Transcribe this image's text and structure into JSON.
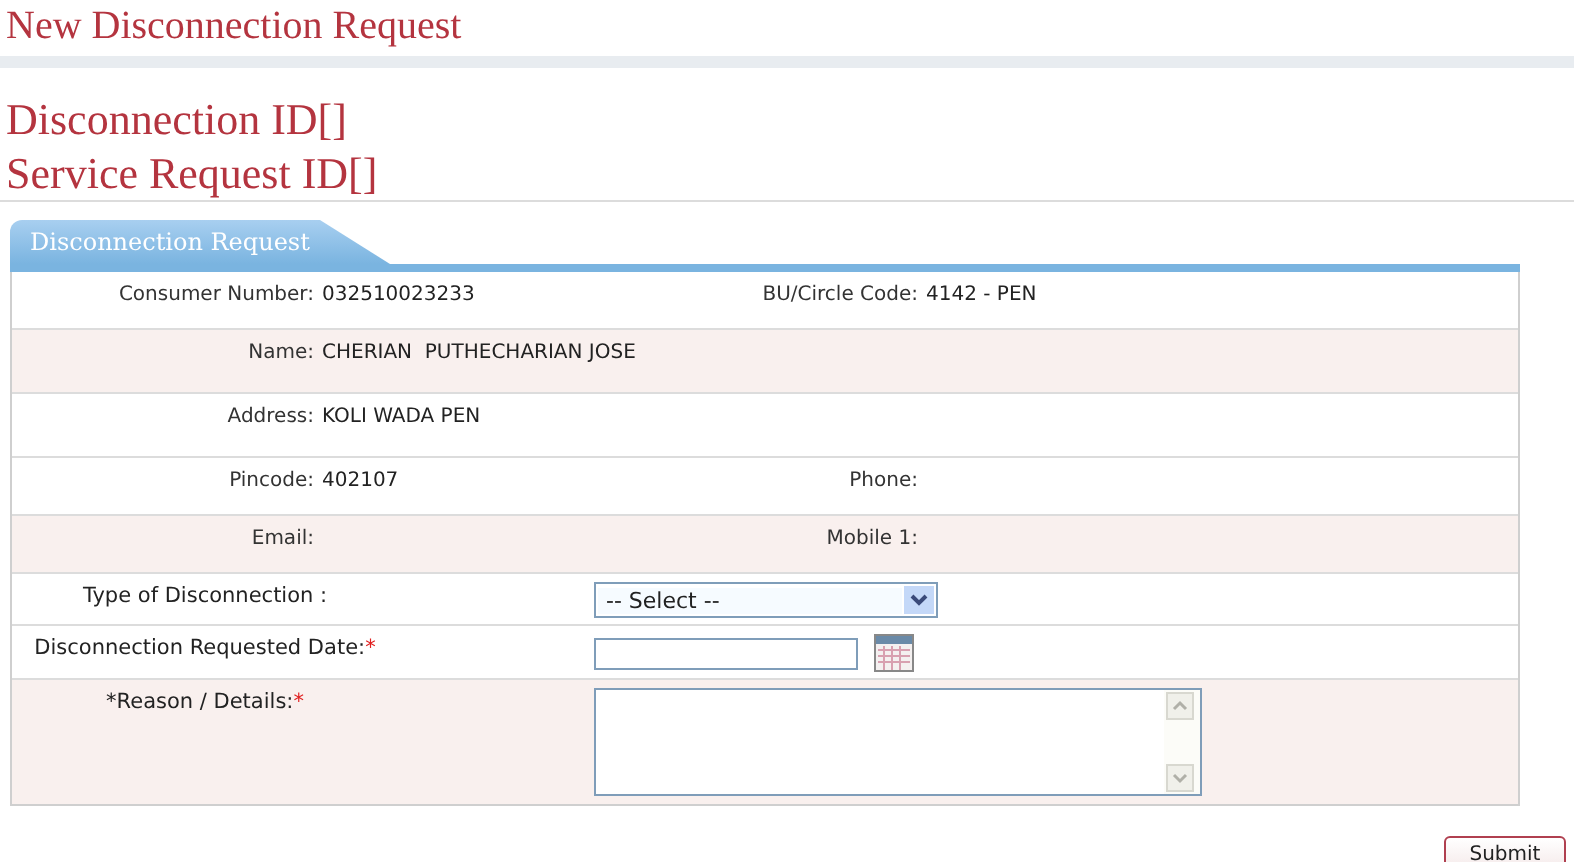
{
  "page_title": "New Disconnection Request",
  "ids": [
    "Disconnection ID[]",
    "Service Request ID[]"
  ],
  "tab": {
    "label": "Disconnection Request"
  },
  "info_rows": [
    {
      "shaded": false,
      "fields": [
        {
          "label": "Consumer Number:",
          "value": "032510023233"
        },
        {
          "label": "BU/Circle Code:",
          "value": "4142 - PEN"
        }
      ]
    },
    {
      "shaded": true,
      "fields": [
        {
          "label": "Name:",
          "value": "CHERIAN  PUTHECHARIAN JOSE"
        }
      ]
    },
    {
      "shaded": false,
      "fields": [
        {
          "label": "Address:",
          "value": "KOLI WADA PEN"
        }
      ]
    },
    {
      "shaded": false,
      "fields": [
        {
          "label": "Pincode:",
          "value": "402107"
        },
        {
          "label": "Phone:"
        }
      ]
    },
    {
      "shaded": true,
      "fields": [
        {
          "label": "Email:"
        },
        {
          "label": "Mobile 1:"
        }
      ]
    }
  ],
  "form_fields": [
    {
      "kind": "select",
      "shaded": false,
      "label": "Type of Disconnection :",
      "value": "-- Select --"
    },
    {
      "kind": "date",
      "shaded": false,
      "label": "Disconnection Requested Date:",
      "mark": "*"
    },
    {
      "kind": "textarea",
      "shaded": true,
      "label": "*Reason / Details:",
      "mark": "*"
    }
  ],
  "submit": "Submit"
}
